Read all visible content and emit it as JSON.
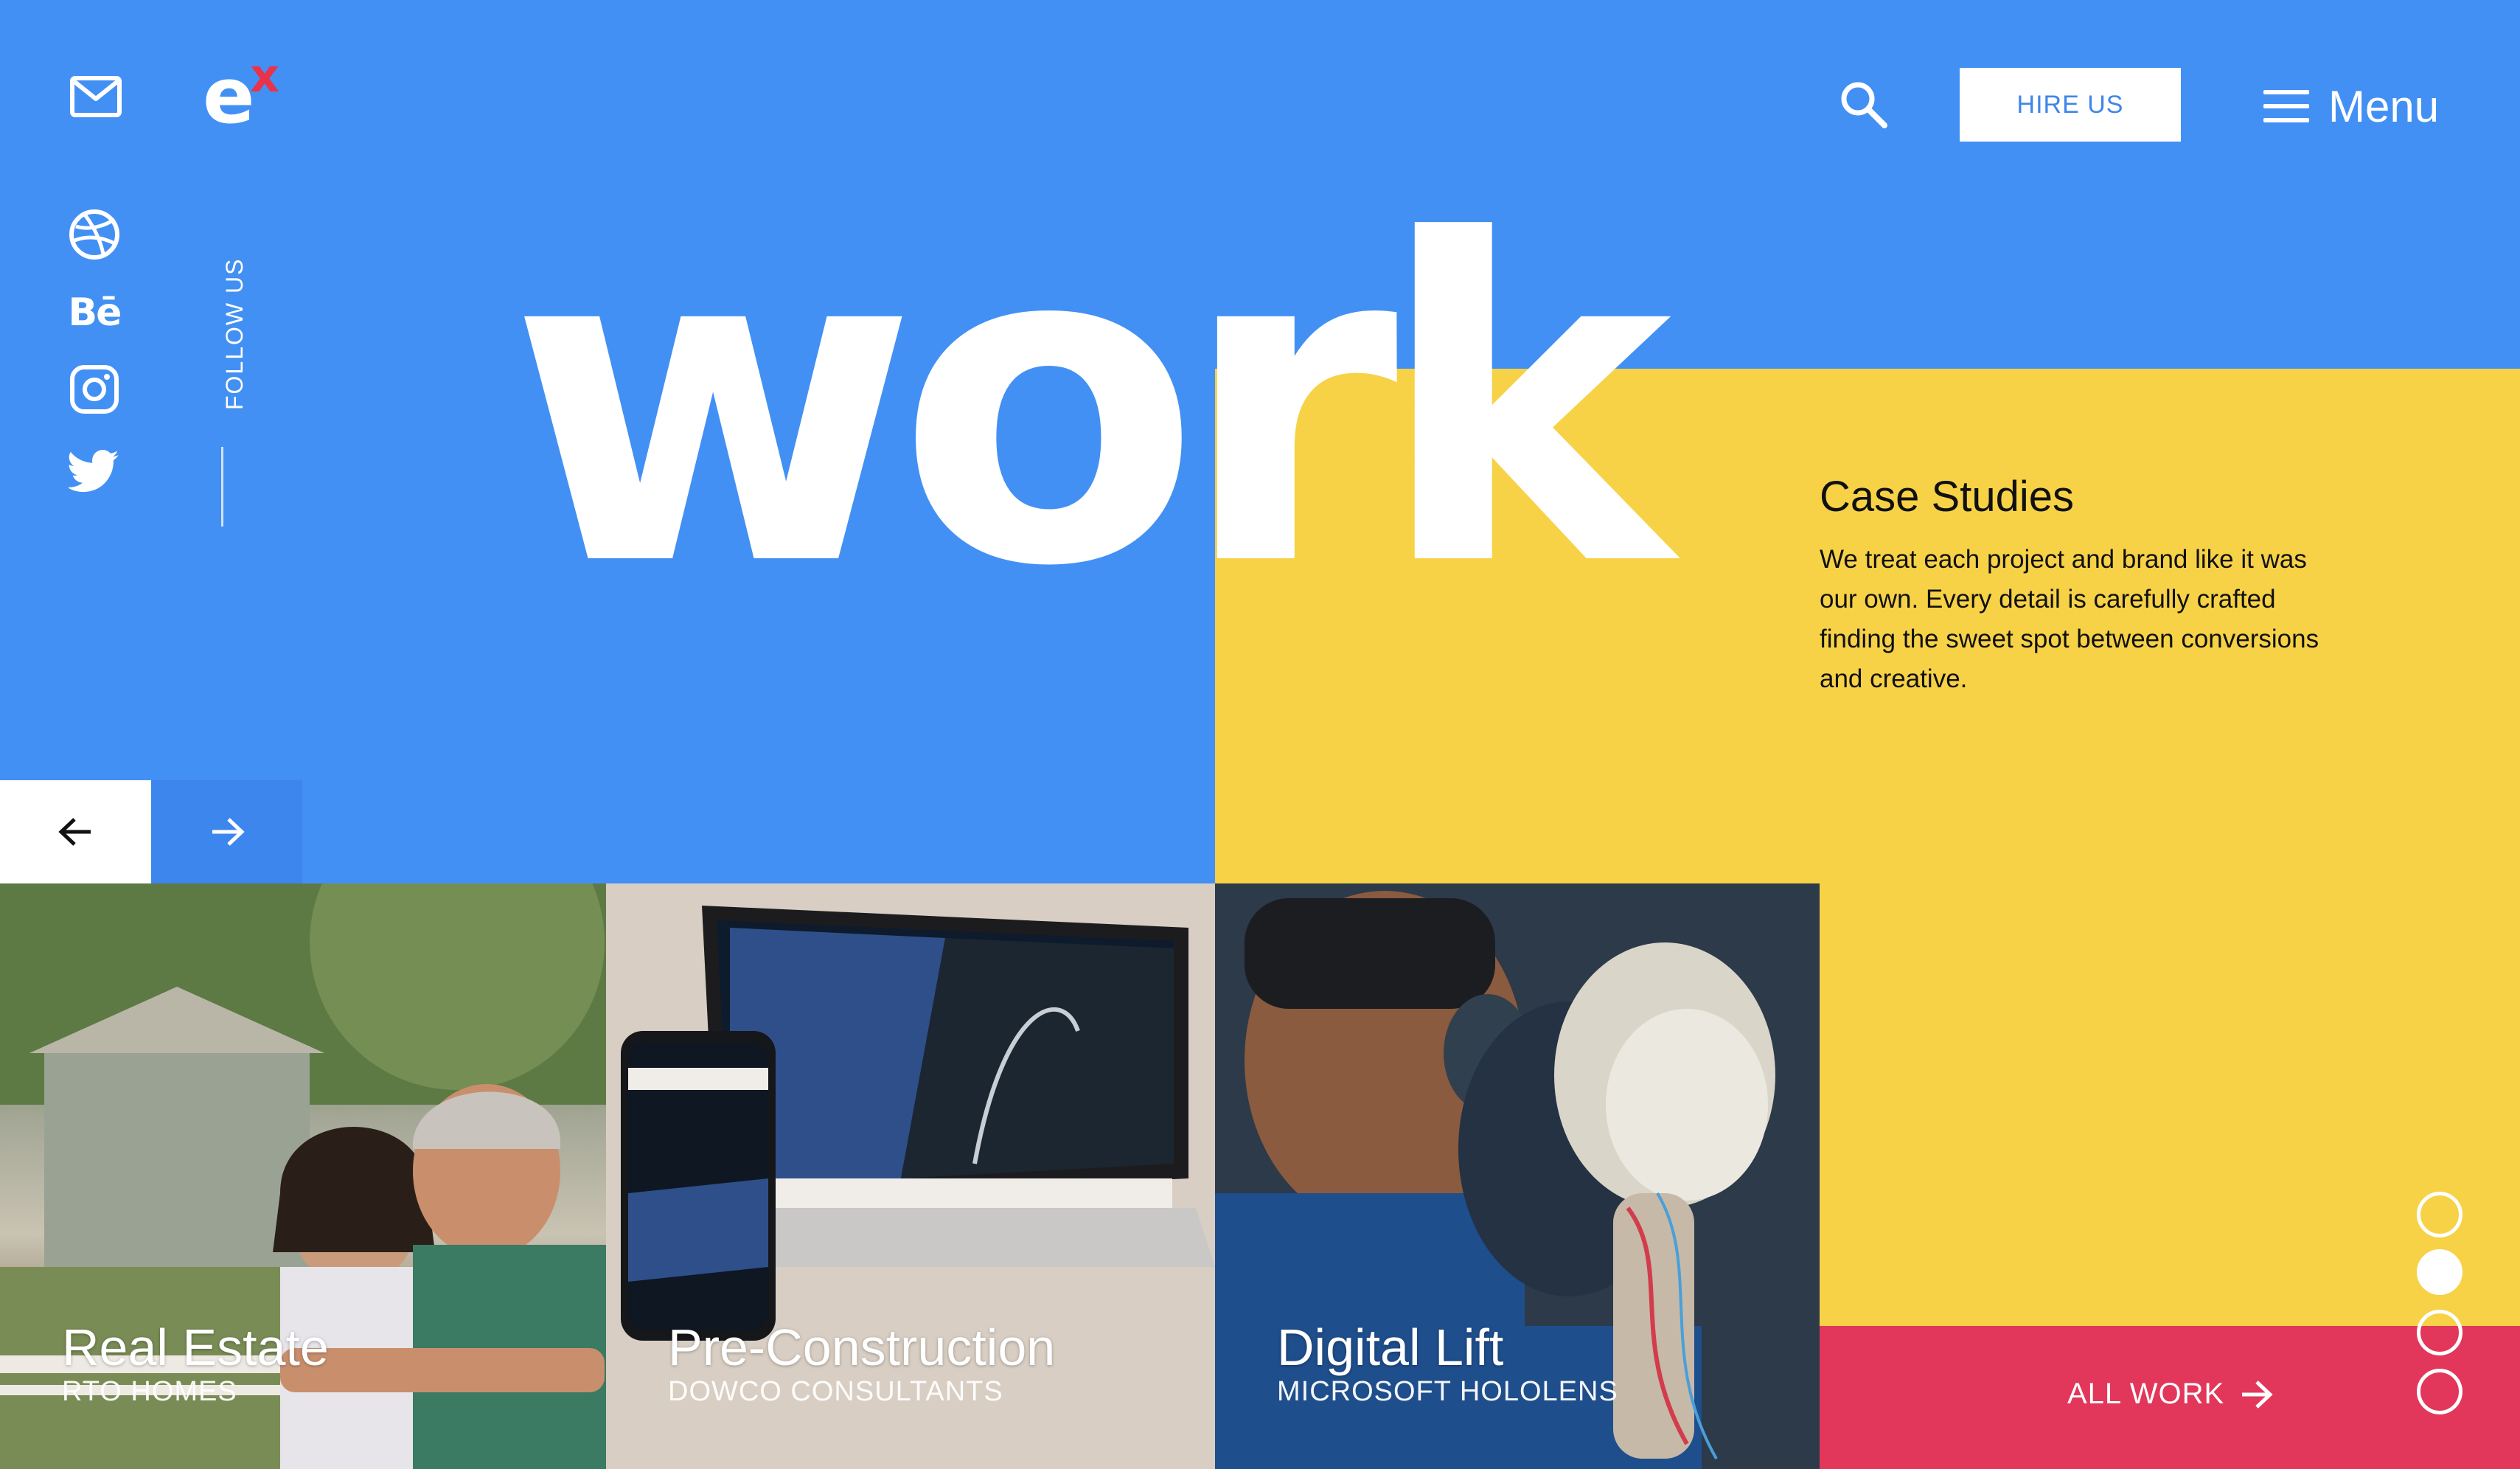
{
  "header": {
    "logo_text": "e",
    "logo_sup": "x",
    "hire_label": "HIRE US",
    "menu_label": "Menu"
  },
  "social": {
    "behance_label": "Bē",
    "follow_label": "FOLLOW US",
    "icons": [
      "dribbble-icon",
      "behance-icon",
      "instagram-icon",
      "twitter-icon"
    ]
  },
  "hero": {
    "headline": "work"
  },
  "case_studies": {
    "title": "Case Studies",
    "text": "We treat each project and brand like it was our own. Every detail is carefully crafted finding the sweet spot between conversions and creative."
  },
  "cards": [
    {
      "title": "Real Estate",
      "subtitle": "RTO HOMES"
    },
    {
      "title": "Pre-Construction",
      "subtitle": "DOWCO CONSULTANTS"
    },
    {
      "title": "Digital Lift",
      "subtitle": "MICROSOFT HOLOLENS"
    }
  ],
  "all_work_label": "ALL WORK",
  "pagination": {
    "total": 4,
    "active": 2
  },
  "colors": {
    "blue": "#4390f4",
    "yellow": "#f7d247",
    "red": "#e2365a",
    "logo_accent": "#e8334a"
  }
}
